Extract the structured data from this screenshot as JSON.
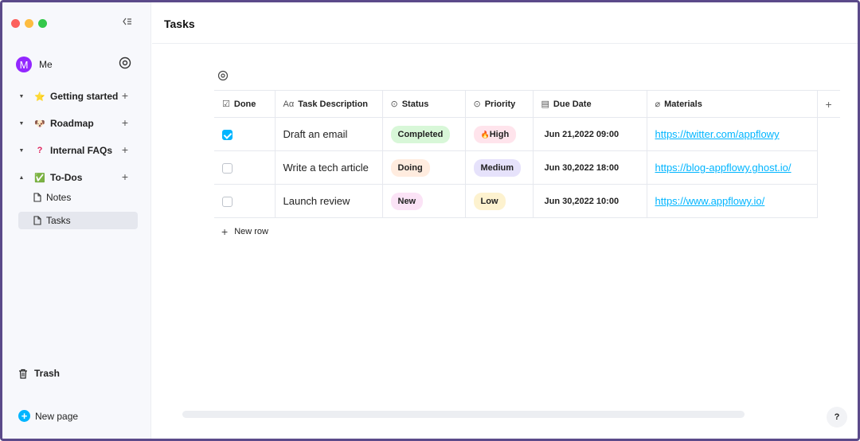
{
  "colors": {
    "accent": "#00b5ff",
    "window_close": "#fc605c",
    "window_minimize": "#fdbc40",
    "window_zoom": "#34c84a",
    "avatar": "#9327ff"
  },
  "sidebar": {
    "user": {
      "avatar_letter": "M",
      "name": "Me"
    },
    "items": [
      {
        "label": "Getting started",
        "icon": "star-icon",
        "emoji": "⭐"
      },
      {
        "label": "Roadmap",
        "icon": "dog-icon",
        "emoji": "🐶"
      },
      {
        "label": "Internal FAQs",
        "icon": "question-icon",
        "emoji": "?"
      },
      {
        "label": "To-Dos",
        "icon": "check-box-icon",
        "emoji": "✅"
      }
    ],
    "sub_items": [
      {
        "label": "Notes"
      },
      {
        "label": "Tasks"
      }
    ],
    "trash_label": "Trash",
    "new_page_label": "New page"
  },
  "main": {
    "title": "Tasks",
    "columns": [
      {
        "label": "Done",
        "icon": "checkbox-icon"
      },
      {
        "label": "Task Description",
        "icon": "text-icon",
        "icon_glyph": "Aα"
      },
      {
        "label": "Status",
        "icon": "select-icon"
      },
      {
        "label": "Priority",
        "icon": "select-icon"
      },
      {
        "label": "Due Date",
        "icon": "calendar-icon"
      },
      {
        "label": "Materials",
        "icon": "paperclip-icon"
      }
    ],
    "rows": [
      {
        "done": true,
        "description": "Draft an email",
        "status": {
          "label": "Completed",
          "color": "#d8f7d8"
        },
        "priority": {
          "label": "High",
          "prefix": "🔥",
          "color": "#ffe4ec"
        },
        "due": "Jun 21,2022  09:00",
        "material": "https://twitter.com/appflowy"
      },
      {
        "done": false,
        "description": "Write a tech article",
        "status": {
          "label": "Doing",
          "color": "#ffecdf"
        },
        "priority": {
          "label": "Medium",
          "prefix": "",
          "color": "#e6e2fb"
        },
        "due": "Jun 30,2022  18:00",
        "material": "https://blog-appflowy.ghost.io/"
      },
      {
        "done": false,
        "description": "Launch review",
        "status": {
          "label": "New",
          "color": "#fbe3f6"
        },
        "priority": {
          "label": "Low",
          "prefix": "",
          "color": "#fdf2cf"
        },
        "due": "Jun 30,2022  10:00",
        "material": "https://www.appflowy.io/"
      }
    ],
    "add_column_label": "+",
    "new_row_label": "New row",
    "help_label": "?"
  }
}
